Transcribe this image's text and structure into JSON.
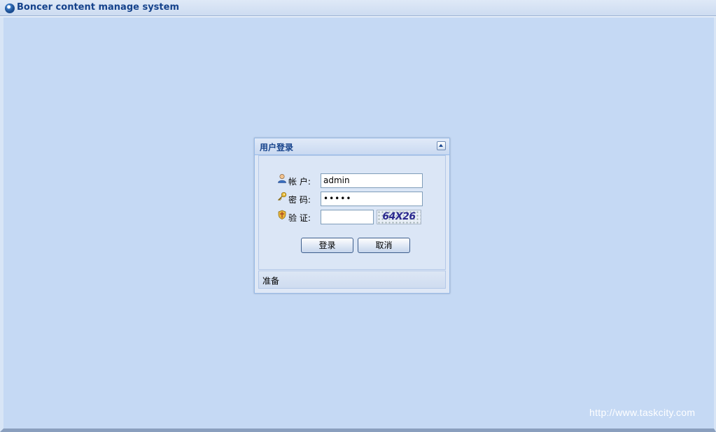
{
  "app": {
    "title": "Boncer content manage system"
  },
  "login": {
    "title": "用户登录",
    "account_label": "帐 户:",
    "account_value": "admin",
    "password_label": "密 码:",
    "password_value": "•••••",
    "verify_label": "验 证:",
    "verify_value": "",
    "captcha_text": "64X26",
    "login_button": "登录",
    "cancel_button": "取消",
    "status": "准备"
  },
  "watermark": "http://www.taskcity.com",
  "colors": {
    "background": "#c5d9f4",
    "header_text": "#15428b",
    "panel_border": "#99bbe8"
  }
}
